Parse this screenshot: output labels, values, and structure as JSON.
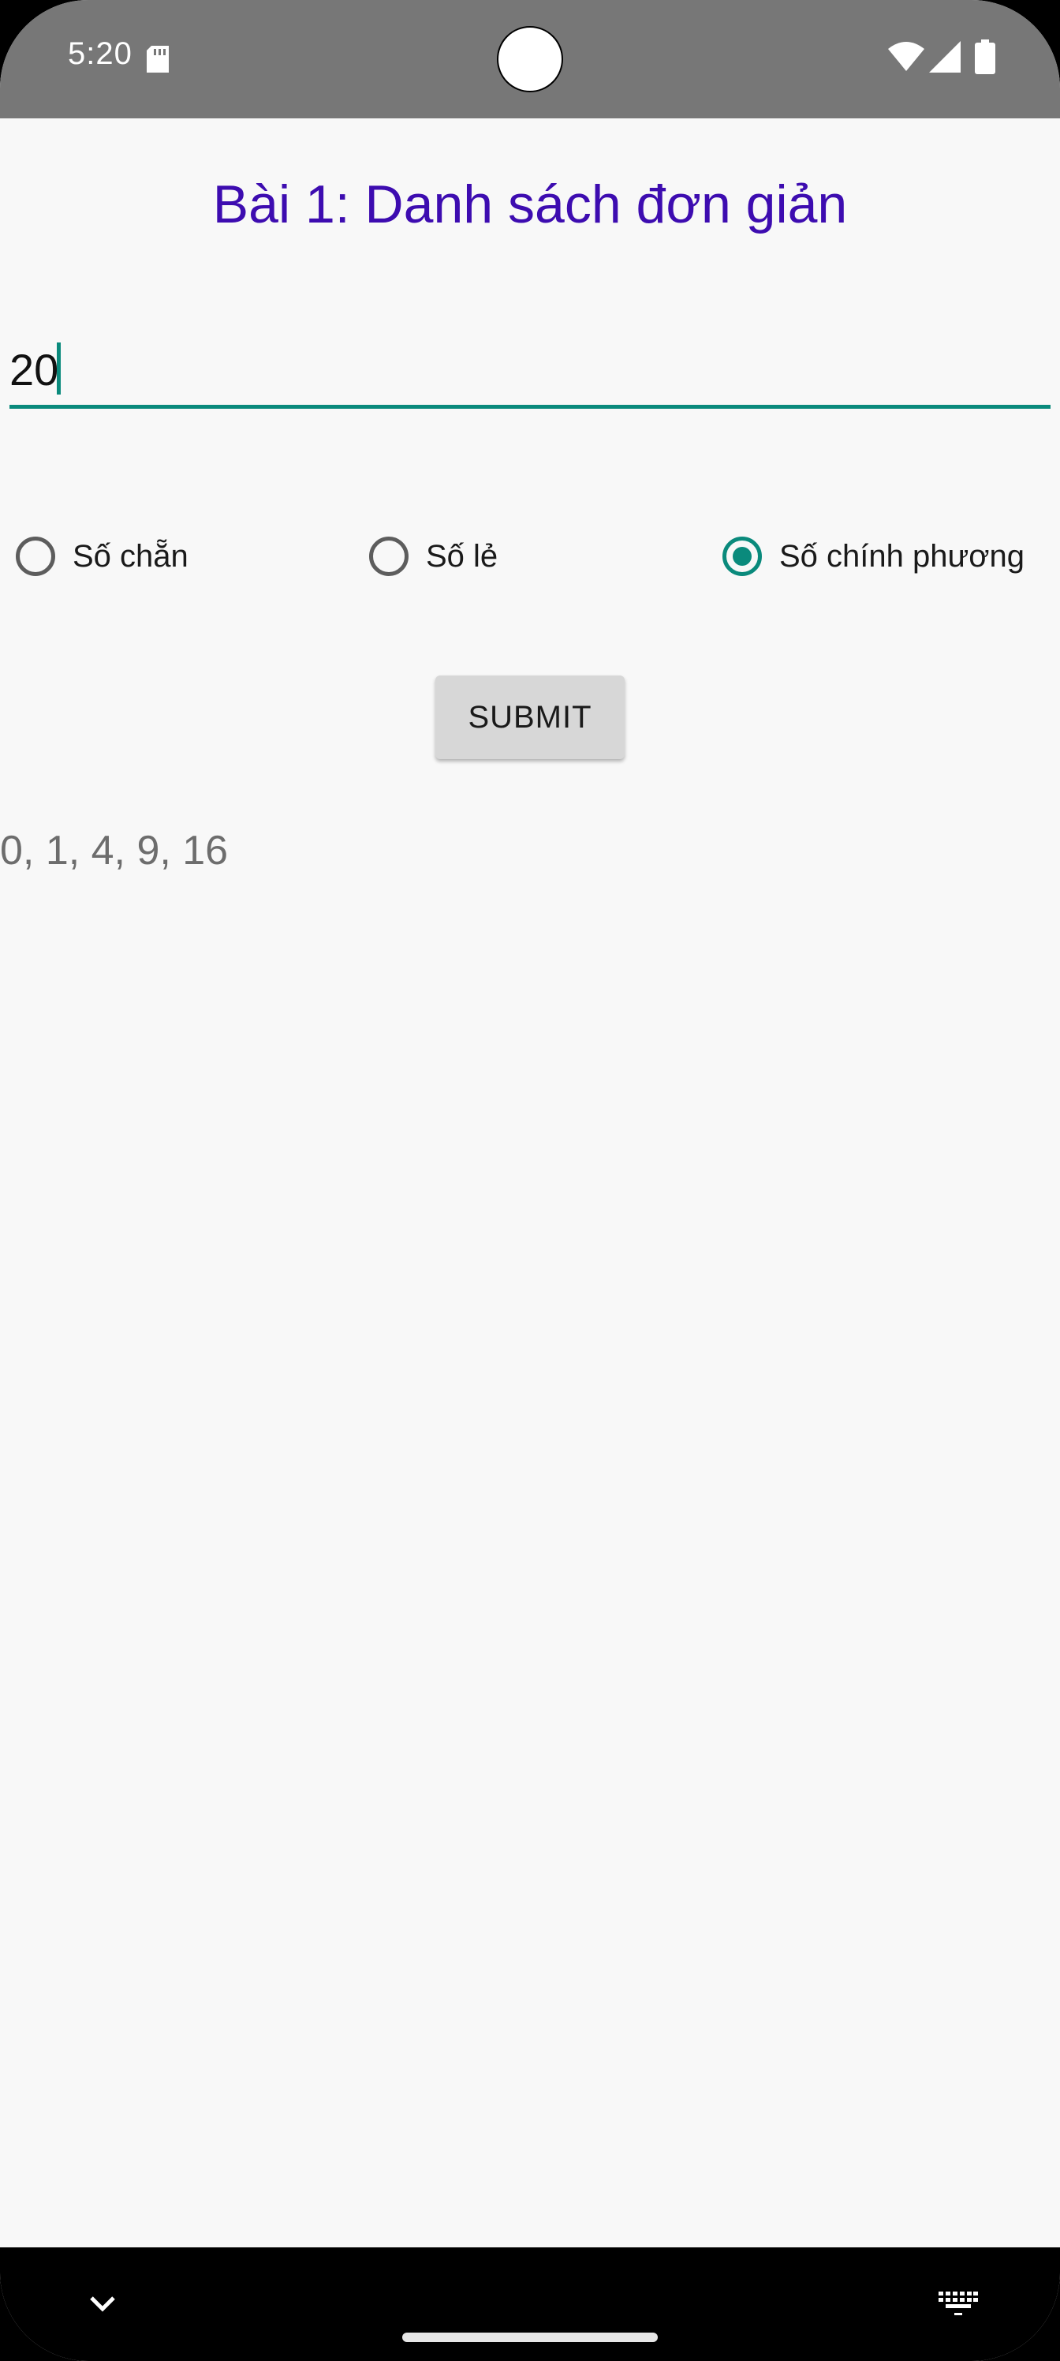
{
  "status_bar": {
    "time": "5:20",
    "icons": [
      "sd-card-icon",
      "wifi-icon",
      "signal-icon",
      "battery-icon"
    ]
  },
  "page": {
    "title": "Bài 1: Danh sách đơn giản"
  },
  "number_input": {
    "value": "20"
  },
  "radio_options": [
    {
      "label": "Số chẵn",
      "checked": false
    },
    {
      "label": "Số lẻ",
      "checked": false
    },
    {
      "label": "Số chính phương",
      "checked": true
    }
  ],
  "submit_button": {
    "label": "SUBMIT"
  },
  "result": {
    "text": "0, 1, 4, 9, 16"
  },
  "nav_bar": {
    "icons": [
      "chevron-down-icon",
      "home-handle",
      "keyboard-icon"
    ]
  },
  "colors": {
    "accent": "#0a8a7c",
    "title": "#3d0cb0",
    "status_bar": "#777777",
    "background": "#f8f8f8"
  }
}
